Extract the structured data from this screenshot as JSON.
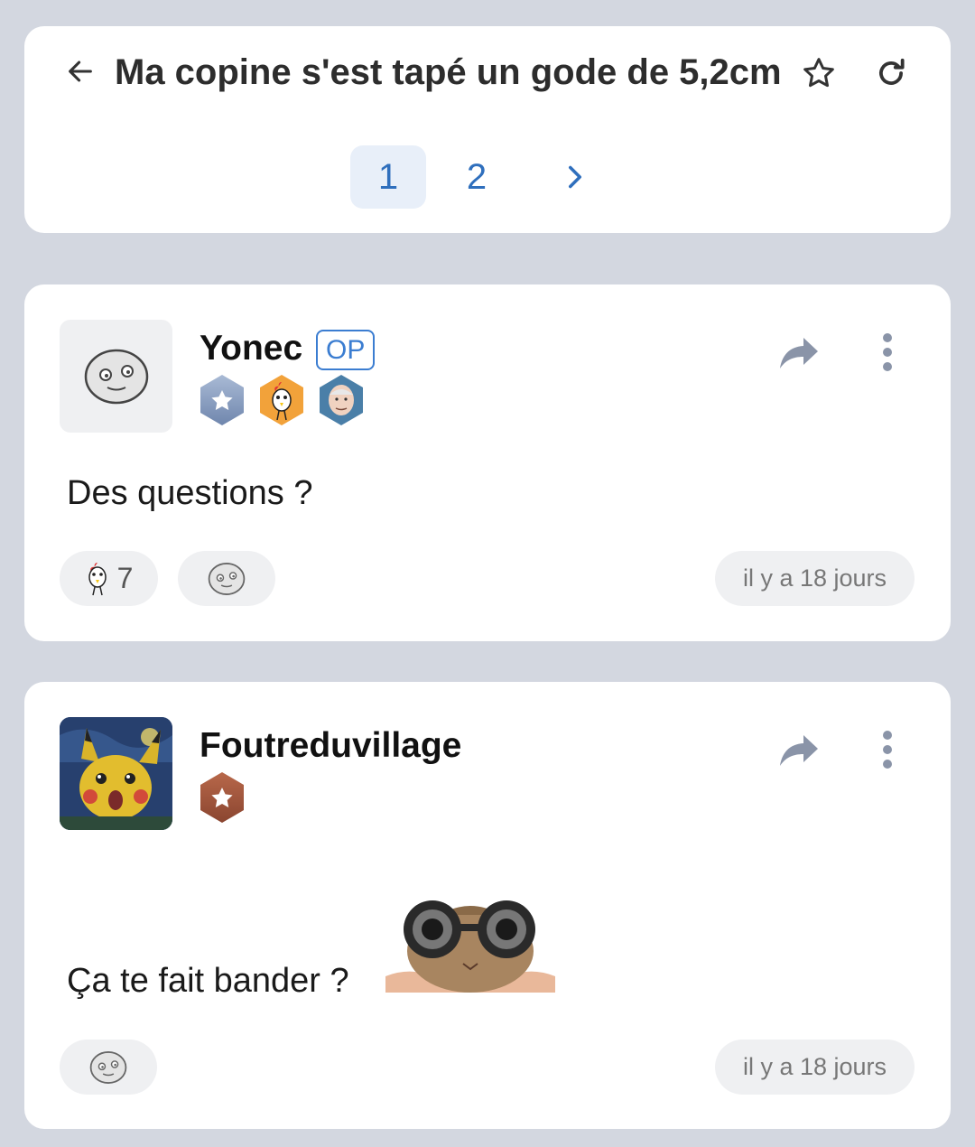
{
  "header": {
    "title": "Ma copine s'est tapé un gode de 5,2cm",
    "pagination": {
      "pages": [
        "1",
        "2"
      ],
      "active": "1",
      "next_label": "›"
    }
  },
  "posts": [
    {
      "author": "Yonec",
      "op_label": "OP",
      "badges": [
        "star-hex-badge",
        "chicken-badge",
        "harold-badge"
      ],
      "text": "Des questions ?",
      "reactions": [
        {
          "emoji": "chicken",
          "count": "7"
        }
      ],
      "date": "il y a 18 jours"
    },
    {
      "author": "Foutreduvillage",
      "badges": [
        "bronze-star-badge"
      ],
      "text": "Ça te fait bander ?",
      "date": "il y a 18 jours"
    }
  ],
  "colors": {
    "accent": "#2f6fbd",
    "background": "#d3d7e0",
    "pill": "#eff0f2"
  }
}
